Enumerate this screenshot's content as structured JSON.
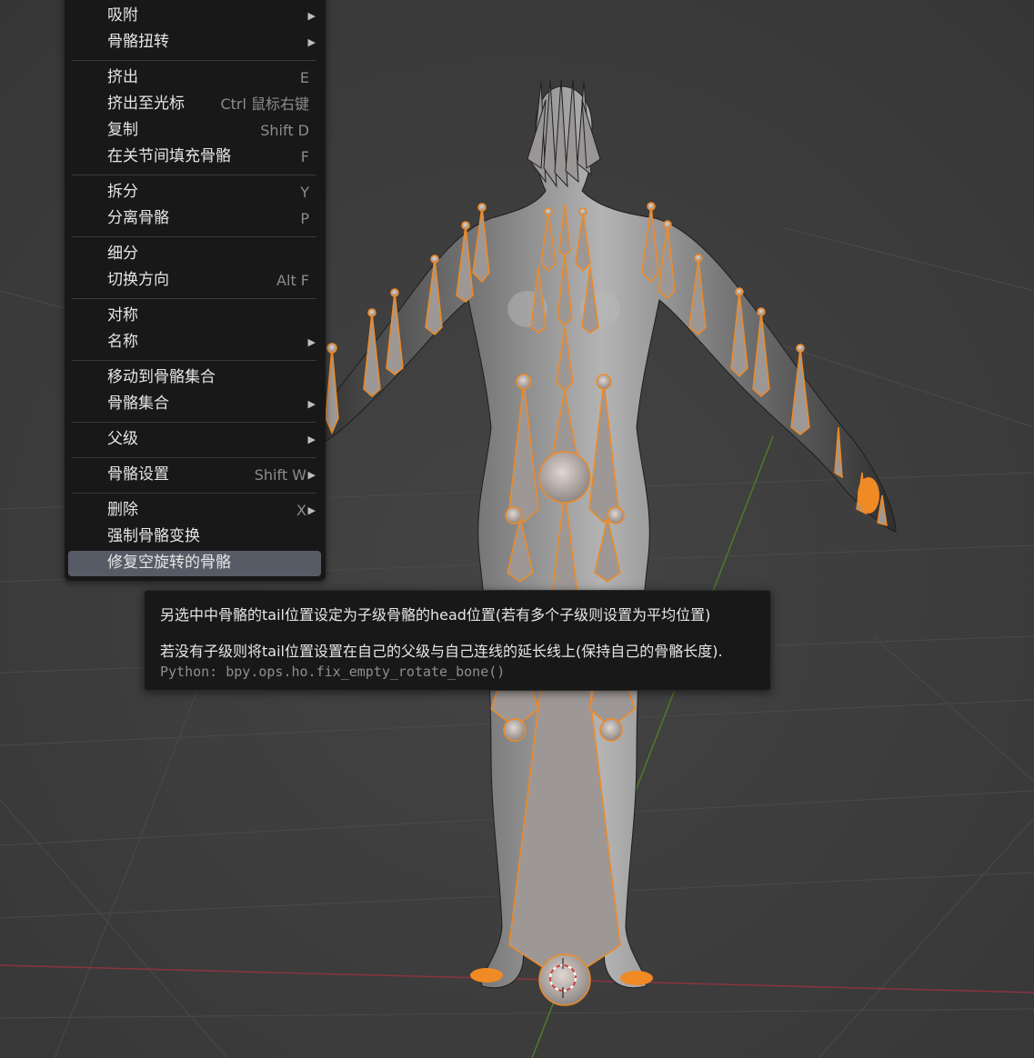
{
  "menu": {
    "items": [
      {
        "label": "吸附",
        "shortcut": "",
        "submenu": true
      },
      {
        "label": "骨骼扭转",
        "shortcut": "",
        "submenu": true
      },
      {
        "label": "挤出",
        "shortcut": "E",
        "submenu": false
      },
      {
        "label": "挤出至光标",
        "shortcut": "Ctrl 鼠标右键",
        "submenu": false
      },
      {
        "label": "复制",
        "shortcut": "Shift D",
        "submenu": false
      },
      {
        "label": "在关节间填充骨骼",
        "shortcut": "F",
        "submenu": false
      },
      {
        "label": "拆分",
        "shortcut": "Y",
        "submenu": false
      },
      {
        "label": "分离骨骼",
        "shortcut": "P",
        "submenu": false
      },
      {
        "label": "细分",
        "shortcut": "",
        "submenu": false
      },
      {
        "label": "切换方向",
        "shortcut": "Alt F",
        "submenu": false
      },
      {
        "label": "对称",
        "shortcut": "",
        "submenu": false
      },
      {
        "label": "名称",
        "shortcut": "",
        "submenu": true
      },
      {
        "label": "移动到骨骼集合",
        "shortcut": "",
        "submenu": false
      },
      {
        "label": "骨骼集合",
        "shortcut": "",
        "submenu": true
      },
      {
        "label": "父级",
        "shortcut": "",
        "submenu": true
      },
      {
        "label": "骨骼设置",
        "shortcut": "Shift W",
        "submenu": true
      },
      {
        "label": "删除",
        "shortcut": "X",
        "submenu": true
      },
      {
        "label": "强制骨骼变换",
        "shortcut": "",
        "submenu": false
      },
      {
        "label": "修复空旋转的骨骼",
        "shortcut": "",
        "submenu": false,
        "active": true
      }
    ]
  },
  "tooltip": {
    "line1": "另选中中骨骼的tail位置设定为子级骨骼的head位置(若有多个子级则设置为平均位置)",
    "line2": "若没有子级则将tail位置设置在自己的父级与自己连线的延长线上(保持自己的骨骼长度).",
    "python": "Python: bpy.ops.ho.fix_empty_rotate_bone()"
  },
  "colors": {
    "viewport_bg": "#3c3c3c",
    "grid": "#494949",
    "x_axis": "#8a3340",
    "y_axis": "#4f7a2a",
    "selected_bone": "#f08a24",
    "bone_fill": "#a09a98",
    "menu_bg": "#181818",
    "menu_highlight": "#575b66"
  },
  "icons": {
    "submenu": "triangle-right-icon",
    "cursor": "3d-cursor-icon"
  }
}
